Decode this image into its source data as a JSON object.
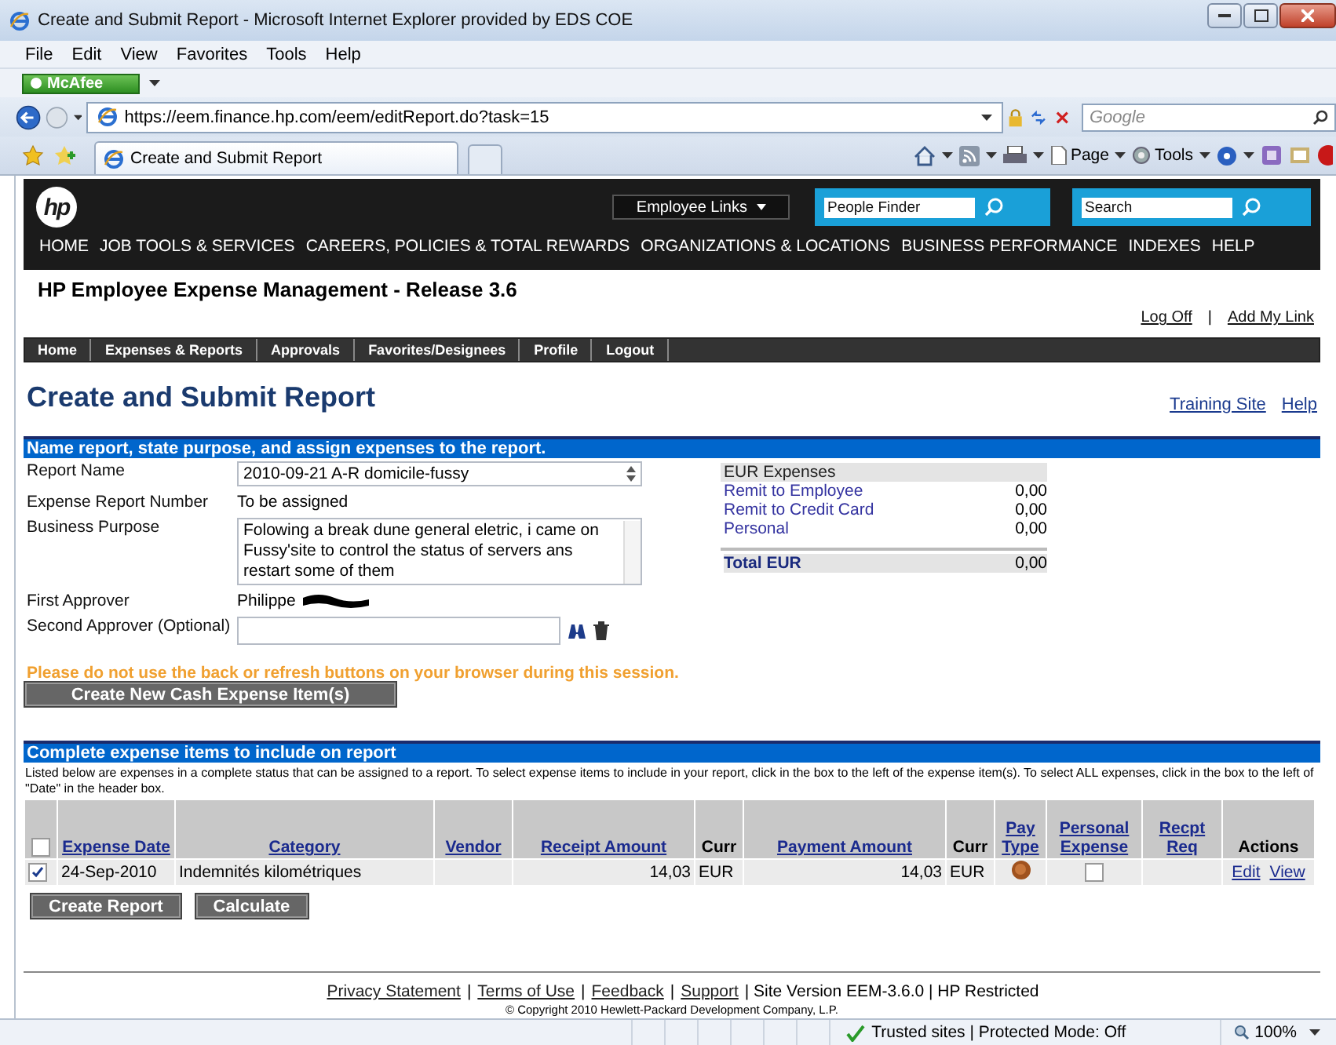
{
  "window": {
    "title": "Create and Submit Report - Microsoft Internet Explorer provided by EDS COE"
  },
  "menu": [
    "File",
    "Edit",
    "View",
    "Favorites",
    "Tools",
    "Help"
  ],
  "mcafee_button": {
    "label": "McAfee"
  },
  "address_bar": {
    "url": "https://eem.finance.hp.com/eem/editReport.do?task=15",
    "search_placeholder": "Google"
  },
  "tabs_bar": {
    "tab_title": "Create and Submit Report",
    "commands": [
      "Page",
      "Tools"
    ]
  },
  "hp_header": {
    "logo": "hp",
    "employee_links": "Employee Links",
    "people_finder": "People Finder",
    "search": "Search",
    "nav": [
      "HOME",
      "JOB TOOLS & SERVICES",
      "CAREERS, POLICIES & TOTAL REWARDS",
      "ORGANIZATIONS & LOCATIONS",
      "BUSINESS PERFORMANCE",
      "INDEXES",
      "HELP"
    ]
  },
  "app_title": "HP Employee Expense Management - Release 3.6",
  "user_links": [
    {
      "kind": "link",
      "text": "Log Off"
    },
    {
      "kind": "text",
      "text": "|"
    },
    {
      "kind": "link",
      "text": "Add My Link"
    }
  ],
  "app_tabs": [
    {
      "label": "Home",
      "selected": false
    },
    {
      "label": "Expenses & Reports",
      "selected": false
    },
    {
      "label": "Approvals",
      "selected": false
    },
    {
      "label": "Favorites/Designees",
      "selected": false
    },
    {
      "label": "Profile",
      "selected": false
    },
    {
      "label": "Logout",
      "selected": false
    }
  ],
  "page": {
    "heading": "Create and Submit Report",
    "links": [
      "Training Site",
      "Help"
    ]
  },
  "report_section": {
    "heading": "Name report, state purpose, and assign expenses to the report.",
    "fields": [
      {
        "kind": "input",
        "label": "Report Name",
        "value": "2010-09-21 A-R domicile-fussy"
      },
      {
        "kind": "text",
        "label": "Expense Report Number",
        "value": "To be assigned"
      },
      {
        "kind": "textarea",
        "label": "Business Purpose",
        "value": "Folowing a break dune general eletric, i came on Fussy'site to control the status of servers ans restart some of them"
      },
      {
        "kind": "redacted",
        "label": "First Approver",
        "value": "Philippe"
      },
      {
        "kind": "lookup",
        "label": "Second Approver (Optional)"
      }
    ],
    "summary": {
      "title": "EUR Expenses",
      "rows": [
        {
          "label": "Remit to Employee",
          "value": "0,00"
        },
        {
          "label": "Remit to Credit Card",
          "value": "0,00"
        },
        {
          "label": "Personal",
          "value": "0,00"
        }
      ],
      "total": {
        "label": "Total EUR",
        "value": "0,00"
      }
    },
    "warning": "Please do not use the back or refresh buttons on your browser during this session.",
    "new_item_button": "Create New Cash Expense Item(s)"
  },
  "expense_section": {
    "heading": "Complete expense items to include on report",
    "description": "Listed below are expenses in a complete status that can be assigned to a report.   To select expense items to include in your report, click in the box to the left of the expense item(s).   To select ALL expenses, click in the box to the left of \"Date\" in the header box.",
    "select_all": {
      "checked": false
    },
    "columns": [
      {
        "label": "Expense Date",
        "sortable": true
      },
      {
        "label": "Category",
        "sortable": true
      },
      {
        "label": "Vendor",
        "sortable": true
      },
      {
        "label": "Receipt Amount",
        "sortable": true
      },
      {
        "label": "Curr",
        "sortable": false
      },
      {
        "label": "Payment Amount",
        "sortable": true
      },
      {
        "label": "Curr",
        "sortable": false
      },
      {
        "label": "Pay Type",
        "sortable": true
      },
      {
        "label": "Personal Expense",
        "sortable": true
      },
      {
        "label": "Recpt Req",
        "sortable": true
      },
      {
        "label": "Actions",
        "sortable": false
      }
    ],
    "rows": [
      {
        "checked": true,
        "expense_date": "24-Sep-2010",
        "category": "Indemnités kilométriques",
        "receipt_amount": "14,03",
        "receipt_curr": "EUR",
        "payment_amount": "14,03",
        "payment_curr": "EUR",
        "personal_expense": false,
        "actions": [
          "Edit",
          "View"
        ]
      }
    ]
  },
  "buttons": [
    "Create Report",
    "Calculate"
  ],
  "footer": {
    "items": [
      {
        "kind": "link",
        "text": "Privacy Statement"
      },
      {
        "kind": "text",
        "text": "|"
      },
      {
        "kind": "link",
        "text": "Terms of Use"
      },
      {
        "kind": "text",
        "text": "|"
      },
      {
        "kind": "link",
        "text": "Feedback"
      },
      {
        "kind": "text",
        "text": "|"
      },
      {
        "kind": "link",
        "text": "Support"
      },
      {
        "kind": "text",
        "text": "| Site Version EEM-3.6.0 | HP Restricted"
      }
    ],
    "copyright": "© Copyright 2010 Hewlett-Packard Development Company, L.P."
  },
  "status_bar": {
    "zone": "Trusted sites | Protected Mode: Off",
    "zoom": "100%"
  }
}
